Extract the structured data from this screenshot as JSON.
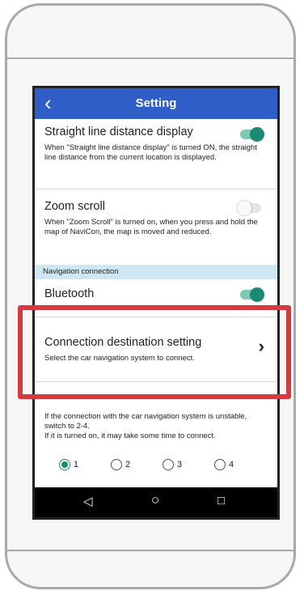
{
  "header": {
    "title": "Setting",
    "back_icon": "chevron-left-icon"
  },
  "settings": {
    "straight_line": {
      "title": "Straight line distance display",
      "description": "When \"Straight line distance display\" is turned ON, the straight line distance from the current location is displayed.",
      "enabled": true
    },
    "zoom_scroll": {
      "title": "Zoom scroll",
      "description": "When \"Zoom Scroll\" is turned on, when you press and hold the map of NaviCon, the map is moved and reduced.",
      "enabled": false
    }
  },
  "section": {
    "label": "Navigation connection"
  },
  "bluetooth": {
    "title": "Bluetooth",
    "enabled": true
  },
  "connection_destination": {
    "title": "Connection destination setting",
    "description": "Select the car navigation system to connect.",
    "chevron": "›"
  },
  "connection_mode": {
    "description_line1": "If the connection with the car navigation system is unstable, switch to 2-4.",
    "description_line2": "If it is turned on, it may take some time to connect.",
    "options": [
      "1",
      "2",
      "3",
      "4"
    ],
    "selected": "1"
  },
  "navbar": {
    "back": "◁",
    "home": "○",
    "recents": "□"
  },
  "colors": {
    "header": "#2f5ec8",
    "accent": "#1a8a72",
    "highlight": "#d43a3f",
    "section_bg": "#cfe6f3"
  }
}
